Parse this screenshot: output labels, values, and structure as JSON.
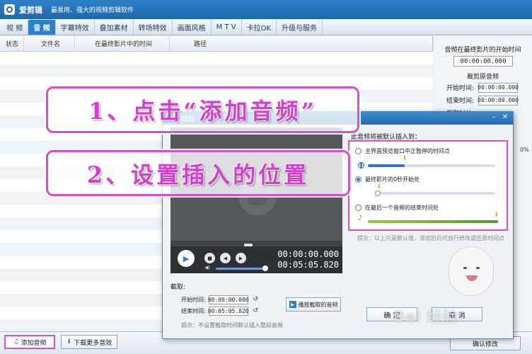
{
  "app": {
    "name": "爱剪辑",
    "slogan": "最易用、强大的视频剪辑软件",
    "brand_color": "#2d7fcb"
  },
  "tabs": [
    {
      "label": "视  频",
      "active": false
    },
    {
      "label": "音  频",
      "active": true
    },
    {
      "label": "字幕特效",
      "active": false
    },
    {
      "label": "叠加素材",
      "active": false
    },
    {
      "label": "转场特效",
      "active": false
    },
    {
      "label": "画面风格",
      "active": false
    },
    {
      "label": "M T V",
      "active": false
    },
    {
      "label": "卡拉OK",
      "active": false
    },
    {
      "label": "升级与服务",
      "active": false
    }
  ],
  "list": {
    "columns": [
      "状态",
      "文件名",
      "在最终影片中的时间",
      "路径"
    ]
  },
  "right_panel": {
    "start_time_title": "音频在最终影片的开始时间",
    "start_time_value": "00:00:00.000",
    "clip_section_title": "裁剪原音频",
    "start_label": "开始时间:",
    "start_value": "00:00:00.000",
    "end_label": "结束时间:",
    "end_value": "00:00:00.000",
    "duration_label": "截取时长:",
    "percent": "0%"
  },
  "bottom": {
    "add_audio": "添加音频",
    "download_more": "下载更多音效",
    "confirm_modify": "确认修改"
  },
  "dialog": {
    "title": "预览/截取",
    "timecode_current": "00:00:00.000",
    "timecode_total": "00:05:05.820",
    "cut_label": "截取:",
    "cut_start_label": "开始时间:",
    "cut_start_value": "00:00:00.000",
    "cut_end_label": "结束时间:",
    "cut_end_value": "00:05:05.820",
    "play_clip_button": "播放截取的音频",
    "cut_tip": "提示：不设置截取时间默认插入整段音频",
    "insert_title": "此音频将被默认插入到：",
    "options": [
      {
        "label": "主界面预览窗口中正暂停的时间点",
        "selected": false
      },
      {
        "label": "最终影片的0秒开始处",
        "selected": true
      },
      {
        "label": "在最后一个音频的结束时间处",
        "selected": false
      }
    ],
    "insert_tip": "提示：以上只是默认值，添加后仍可自行修改或任意时间点",
    "ok": "确 定",
    "cancel": "取 消"
  },
  "annotations": {
    "step1": "1、点击“添加音频”",
    "step2": "2、设置插入的位置",
    "color": "#d64fd0"
  },
  "watermark": "Bai 经验"
}
